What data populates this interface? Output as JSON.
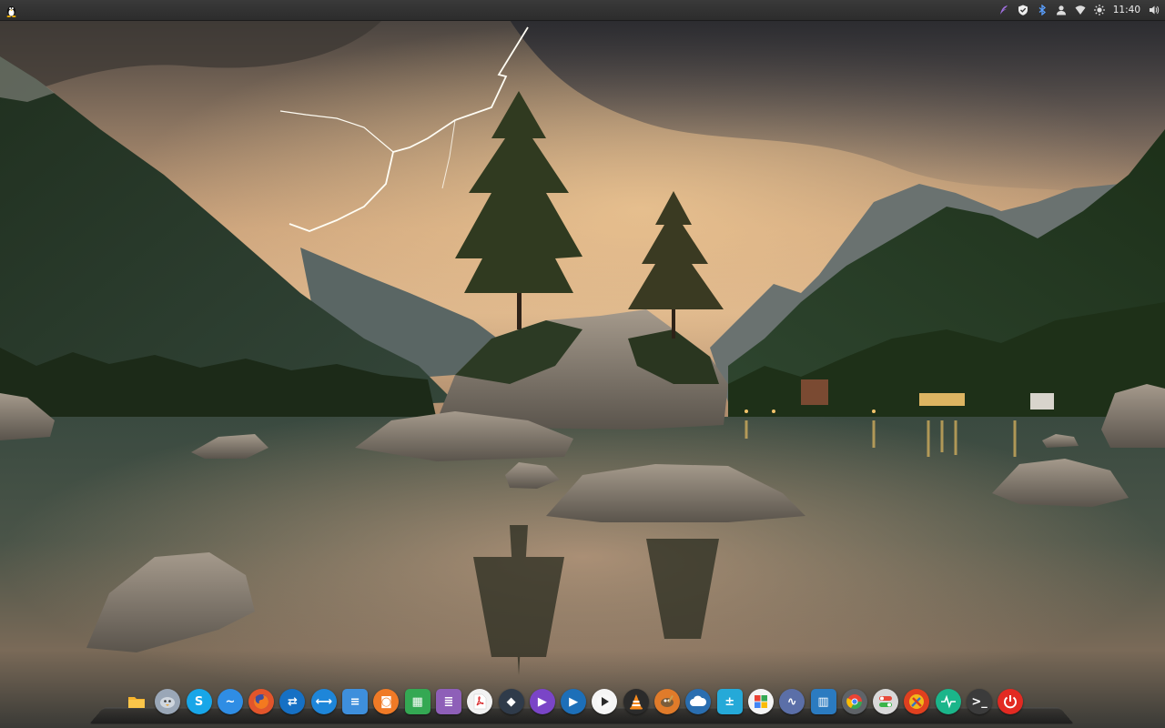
{
  "panel": {
    "clock": "11:40",
    "tray": [
      "feather-icon",
      "shield-icon",
      "bluetooth-icon",
      "user-icon",
      "wifi-icon",
      "brightness-icon",
      "volume-icon"
    ],
    "launcher": "tux-icon"
  },
  "dock": {
    "items": [
      {
        "name": "files-icon",
        "color": "#f59a1e",
        "glyph": ""
      },
      {
        "name": "pidgin-icon",
        "color": "#9aa7b7",
        "glyph": ""
      },
      {
        "name": "skype-icon",
        "color": "#18a6e8",
        "glyph": "S"
      },
      {
        "name": "messenger-icon",
        "color": "#2f8de4",
        "glyph": "~"
      },
      {
        "name": "firefox-icon",
        "color": "#e2552b",
        "glyph": ""
      },
      {
        "name": "teamviewer-icon",
        "color": "#1670c4",
        "glyph": "⇄"
      },
      {
        "name": "remote-desktop-icon",
        "color": "#1e86d9",
        "glyph": "⟷"
      },
      {
        "name": "document-viewer-icon",
        "color": "#3e8fdc",
        "glyph": "≡"
      },
      {
        "name": "screenshot-icon",
        "color": "#f07a26",
        "glyph": "◙"
      },
      {
        "name": "spreadsheet-icon",
        "color": "#34a853",
        "glyph": "▦"
      },
      {
        "name": "text-editor-icon",
        "color": "#8e5fb8",
        "glyph": "≣"
      },
      {
        "name": "pdf-icon",
        "color": "#f2f2f2",
        "glyph": ""
      },
      {
        "name": "kodi-icon",
        "color": "#2f3b4a",
        "glyph": "◆"
      },
      {
        "name": "media-player-icon",
        "color": "#7a45c7",
        "glyph": "▶"
      },
      {
        "name": "video-player-icon",
        "color": "#1d6fb8",
        "glyph": "▶"
      },
      {
        "name": "mpv-icon",
        "color": "#f5f5f5",
        "glyph": ""
      },
      {
        "name": "vlc-icon",
        "color": "#2b2b2b",
        "glyph": ""
      },
      {
        "name": "gimp-icon",
        "color": "#e07b2a",
        "glyph": ""
      },
      {
        "name": "cloud-icon",
        "color": "#2a6eb0",
        "glyph": ""
      },
      {
        "name": "calculator-icon",
        "color": "#25a9d8",
        "glyph": "±"
      },
      {
        "name": "software-center-icon",
        "color": "#f4f4f4",
        "glyph": ""
      },
      {
        "name": "settings-wave-icon",
        "color": "#5b6fa8",
        "glyph": "∿"
      },
      {
        "name": "system-monitor-icon",
        "color": "#2b7bc0",
        "glyph": "▥"
      },
      {
        "name": "chromium-icon",
        "color": "#5f6368",
        "glyph": ""
      },
      {
        "name": "toggle-icon",
        "color": "#d9d9d9",
        "glyph": ""
      },
      {
        "name": "tools-icon",
        "color": "#e0401f",
        "glyph": ""
      },
      {
        "name": "activity-monitor-icon",
        "color": "#1bb58a",
        "glyph": ""
      },
      {
        "name": "terminal-icon",
        "color": "#3b3b3b",
        "glyph": ">_"
      },
      {
        "name": "power-icon",
        "color": "#e22a22",
        "glyph": ""
      }
    ]
  }
}
